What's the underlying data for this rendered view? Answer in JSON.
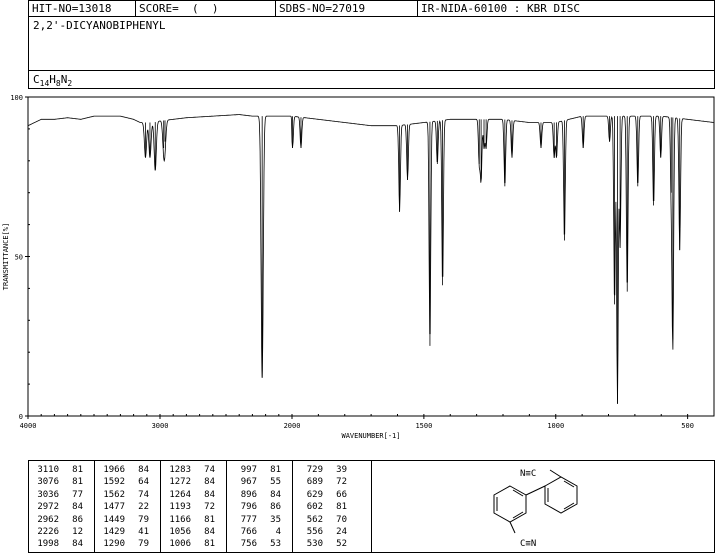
{
  "header": {
    "hit_no": "HIT-NO=13018",
    "score": "SCORE=  (  )",
    "sdbs_no": "SDBS-NO=27019",
    "method": "IR-NIDA-60100 : KBR DISC"
  },
  "compound": {
    "name": "2,2'-DICYANOBIPHENYL",
    "formula": "C14H8N2"
  },
  "chart_data": {
    "type": "line",
    "xlabel": "WAVENUMBER[-1]",
    "ylabel": "TRANSMITTANCE[%]",
    "xlim": [
      4000,
      400
    ],
    "ylim": [
      0,
      100
    ],
    "x_ticks": [
      4000,
      3000,
      2000,
      1500,
      1000,
      500
    ],
    "y_ticks": [
      0,
      50,
      100
    ],
    "baseline": [
      [
        4000,
        91
      ],
      [
        3900,
        93
      ],
      [
        3800,
        93
      ],
      [
        3700,
        93.5
      ],
      [
        3600,
        93
      ],
      [
        3500,
        94
      ],
      [
        3300,
        94
      ],
      [
        3200,
        93
      ],
      [
        3150,
        92
      ],
      [
        3050,
        92
      ],
      [
        3000,
        92.5
      ],
      [
        2900,
        93
      ],
      [
        2800,
        93.5
      ],
      [
        2600,
        94
      ],
      [
        2400,
        94.5
      ],
      [
        2300,
        94
      ],
      [
        2200,
        94
      ],
      [
        2000,
        94
      ],
      [
        1900,
        93
      ],
      [
        1800,
        92
      ],
      [
        1700,
        91
      ],
      [
        1600,
        91
      ],
      [
        1500,
        92
      ],
      [
        1400,
        93
      ],
      [
        1300,
        93
      ],
      [
        1200,
        93
      ],
      [
        1100,
        92
      ],
      [
        1000,
        92
      ],
      [
        900,
        94
      ],
      [
        800,
        94
      ],
      [
        700,
        94
      ],
      [
        600,
        94
      ],
      [
        500,
        93
      ],
      [
        400,
        92
      ]
    ],
    "peaks": [
      {
        "wavenumber": 3110,
        "transmittance": 81
      },
      {
        "wavenumber": 3076,
        "transmittance": 81
      },
      {
        "wavenumber": 3036,
        "transmittance": 77
      },
      {
        "wavenumber": 2972,
        "transmittance": 84
      },
      {
        "wavenumber": 2962,
        "transmittance": 86
      },
      {
        "wavenumber": 2226,
        "transmittance": 12
      },
      {
        "wavenumber": 1998,
        "transmittance": 84
      },
      {
        "wavenumber": 1966,
        "transmittance": 84
      },
      {
        "wavenumber": 1592,
        "transmittance": 64
      },
      {
        "wavenumber": 1562,
        "transmittance": 74
      },
      {
        "wavenumber": 1477,
        "transmittance": 22
      },
      {
        "wavenumber": 1449,
        "transmittance": 79
      },
      {
        "wavenumber": 1429,
        "transmittance": 41
      },
      {
        "wavenumber": 1290,
        "transmittance": 79
      },
      {
        "wavenumber": 1283,
        "transmittance": 74
      },
      {
        "wavenumber": 1272,
        "transmittance": 84
      },
      {
        "wavenumber": 1264,
        "transmittance": 84
      },
      {
        "wavenumber": 1193,
        "transmittance": 72
      },
      {
        "wavenumber": 1166,
        "transmittance": 81
      },
      {
        "wavenumber": 1056,
        "transmittance": 84
      },
      {
        "wavenumber": 1006,
        "transmittance": 81
      },
      {
        "wavenumber": 997,
        "transmittance": 81
      },
      {
        "wavenumber": 967,
        "transmittance": 55
      },
      {
        "wavenumber": 896,
        "transmittance": 84
      },
      {
        "wavenumber": 796,
        "transmittance": 86
      },
      {
        "wavenumber": 777,
        "transmittance": 35
      },
      {
        "wavenumber": 766,
        "transmittance": 4
      },
      {
        "wavenumber": 756,
        "transmittance": 53
      },
      {
        "wavenumber": 729,
        "transmittance": 39
      },
      {
        "wavenumber": 689,
        "transmittance": 72
      },
      {
        "wavenumber": 629,
        "transmittance": 66
      },
      {
        "wavenumber": 602,
        "transmittance": 81
      },
      {
        "wavenumber": 562,
        "transmittance": 70
      },
      {
        "wavenumber": 556,
        "transmittance": 24
      },
      {
        "wavenumber": 530,
        "transmittance": 52
      }
    ]
  },
  "peak_table": [
    [
      [
        "3110",
        "81"
      ],
      [
        "3076",
        "81"
      ],
      [
        "3036",
        "77"
      ],
      [
        "2972",
        "84"
      ],
      [
        "2962",
        "86"
      ],
      [
        "2226",
        "12"
      ],
      [
        "1998",
        "84"
      ]
    ],
    [
      [
        "1966",
        "84"
      ],
      [
        "1592",
        "64"
      ],
      [
        "1562",
        "74"
      ],
      [
        "1477",
        "22"
      ],
      [
        "1449",
        "79"
      ],
      [
        "1429",
        "41"
      ],
      [
        "1290",
        "79"
      ]
    ],
    [
      [
        "1283",
        "74"
      ],
      [
        "1272",
        "84"
      ],
      [
        "1264",
        "84"
      ],
      [
        "1193",
        "72"
      ],
      [
        "1166",
        "81"
      ],
      [
        "1056",
        "84"
      ],
      [
        "1006",
        "81"
      ]
    ],
    [
      [
        "997",
        "81"
      ],
      [
        "967",
        "55"
      ],
      [
        "896",
        "84"
      ],
      [
        "796",
        "86"
      ],
      [
        "777",
        "35"
      ],
      [
        "766",
        "4"
      ],
      [
        "756",
        "53"
      ]
    ],
    [
      [
        "729",
        "39"
      ],
      [
        "689",
        "72"
      ],
      [
        "629",
        "66"
      ],
      [
        "602",
        "81"
      ],
      [
        "562",
        "70"
      ],
      [
        "556",
        "24"
      ],
      [
        "530",
        "52"
      ]
    ]
  ],
  "structure": {
    "top_label": "N≡C",
    "bottom_label": "C≡N"
  }
}
